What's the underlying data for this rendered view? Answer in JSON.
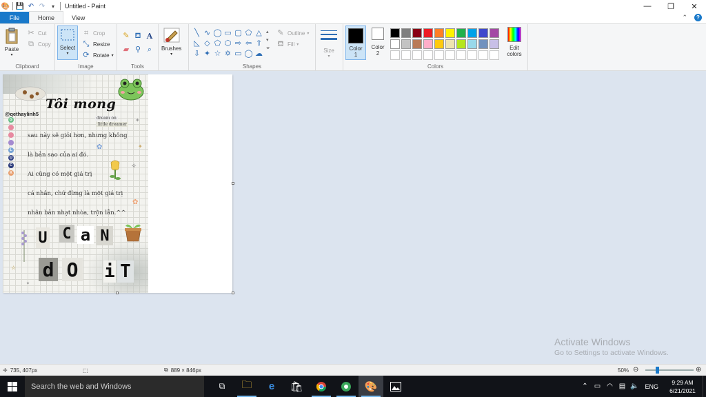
{
  "window": {
    "title": "Untitled - Paint",
    "minimize_glyph": "—",
    "maximize_glyph": "❐",
    "close_glyph": "✕"
  },
  "ribbon_tabs": {
    "file": "File",
    "home": "Home",
    "view": "View"
  },
  "clipboard": {
    "paste": "Paste",
    "cut": "Cut",
    "copy": "Copy",
    "label": "Clipboard"
  },
  "image": {
    "select": "Select",
    "crop": "Crop",
    "resize": "Resize",
    "rotate": "Rotate",
    "label": "Image"
  },
  "tools": {
    "label": "Tools",
    "items": [
      "pencil-icon",
      "fill-icon",
      "text-icon",
      "eraser-icon",
      "color-picker-icon",
      "magnifier-icon"
    ]
  },
  "brushes": {
    "label": "Brushes"
  },
  "shapes": {
    "label": "Shapes",
    "outline": "Outline",
    "fill": "Fill"
  },
  "size": {
    "label": "Size"
  },
  "colors": {
    "color1_label": "Color",
    "color1_num": "1",
    "color2_label": "Color",
    "color2_num": "2",
    "edit_colors_line1": "Edit",
    "edit_colors_line2": "colors",
    "label": "Colors",
    "color1_value": "#000000",
    "color2_value": "#ffffff",
    "palette": [
      "#000000",
      "#7f7f7f",
      "#880015",
      "#ed1c24",
      "#ff7f27",
      "#fff200",
      "#22b14c",
      "#00a2e8",
      "#3f48cc",
      "#a349a4",
      "#ffffff",
      "#c3c3c3",
      "#b97a57",
      "#ffaec9",
      "#ffc90e",
      "#efe4b0",
      "#b5e61d",
      "#99d9ea",
      "#7092be",
      "#c8bfe7",
      "#ffffff",
      "#ffffff",
      "#ffffff",
      "#ffffff",
      "#ffffff",
      "#ffffff",
      "#ffffff",
      "#ffffff",
      "#ffffff",
      "#ffffff"
    ]
  },
  "artwork": {
    "handle": "@qethaylinh5",
    "title": "Tôi mong",
    "sub1": "dream on",
    "sub2": "little dreamer",
    "lines": [
      "sau này sẽ giỏi hơn, nhưng không",
      "là bản sao của ai đó.",
      "Ai cũng có một giá trị",
      "cá nhân, chứ đừng là một giá trị",
      "nhân bản nhạt nhòa, trộn lẫn.^^"
    ],
    "dots": [
      "G",
      "",
      "",
      "",
      "L",
      "U",
      "C",
      "K"
    ],
    "cutout_row1": [
      "U",
      "C",
      "a",
      "N"
    ],
    "cutout_row2": [
      "d",
      "O",
      "i",
      "T"
    ]
  },
  "status": {
    "cursor_pos": "735, 407px",
    "image_size": "889 × 846px",
    "zoom": "50%"
  },
  "watermark": {
    "line1": "Activate Windows",
    "line2": "Go to Settings to activate Windows."
  },
  "taskbar": {
    "search_placeholder": "Search the web and Windows",
    "lang": "ENG",
    "time": "9:29 AM",
    "date": "6/21/2021"
  }
}
